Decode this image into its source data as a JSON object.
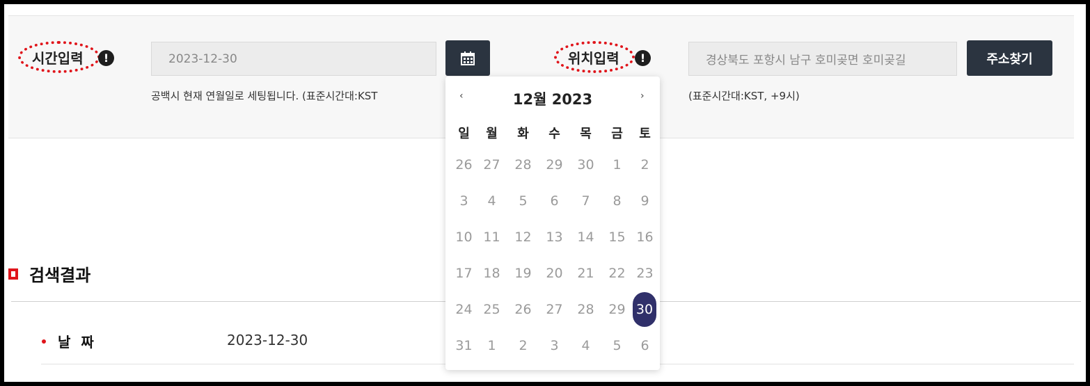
{
  "form": {
    "time_label": "시간입력",
    "time_value": "2023-12-30",
    "time_help": "공백시 현재 연월일로 세팅됩니다. (표준시간대:KST",
    "location_label": "위치입력",
    "location_value": "경상북도 포항시 남구 호미곶면 호미곶길",
    "location_help": "(표준시간대:KST, +9시)",
    "find_address_label": "주소찾기",
    "info_icon_glyph": "!"
  },
  "calendar": {
    "title": "12월 2023",
    "prev": "‹",
    "next": "›",
    "weekdays": [
      "일",
      "월",
      "화",
      "수",
      "목",
      "금",
      "토"
    ],
    "weeks": [
      [
        "26",
        "27",
        "28",
        "29",
        "30",
        "1",
        "2"
      ],
      [
        "3",
        "4",
        "5",
        "6",
        "7",
        "8",
        "9"
      ],
      [
        "10",
        "11",
        "12",
        "13",
        "14",
        "15",
        "16"
      ],
      [
        "17",
        "18",
        "19",
        "20",
        "21",
        "22",
        "23"
      ],
      [
        "24",
        "25",
        "26",
        "27",
        "28",
        "29",
        "30"
      ],
      [
        "31",
        "1",
        "2",
        "3",
        "4",
        "5",
        "6"
      ]
    ],
    "selected_week": 4,
    "selected_day": 6,
    "selected_color": "#30306a"
  },
  "results": {
    "title": "검색결과",
    "rows": [
      {
        "label": "날 짜",
        "value": "2023-12-30"
      }
    ]
  },
  "colors": {
    "accent_red": "#e0151b",
    "button_dark": "#2b3440"
  }
}
